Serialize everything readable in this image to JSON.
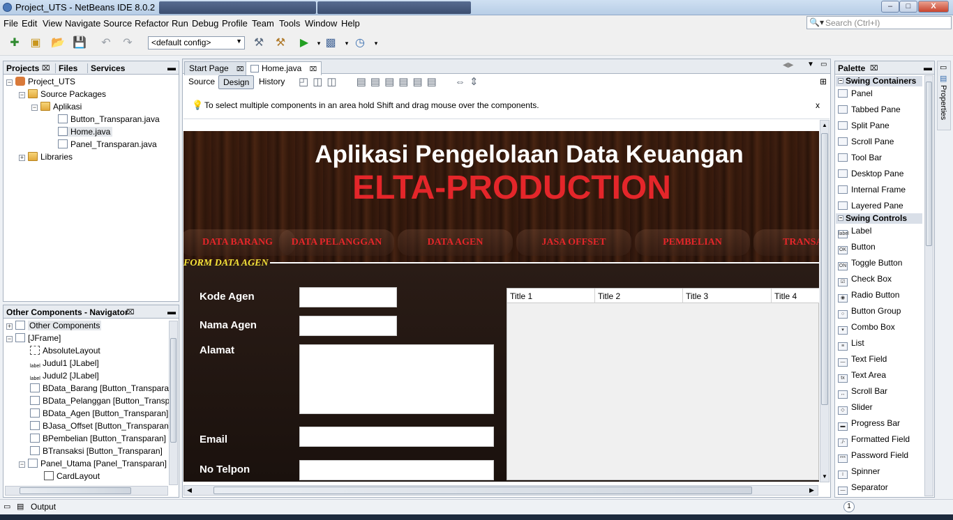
{
  "window": {
    "title": "Project_UTS - NetBeans IDE 8.0.2"
  },
  "menu": [
    "File",
    "Edit",
    "View",
    "Navigate",
    "Source",
    "Refactor",
    "Run",
    "Debug",
    "Profile",
    "Team",
    "Tools",
    "Window",
    "Help"
  ],
  "search": {
    "placeholder": "Search (Ctrl+I)"
  },
  "toolbar": {
    "config_value": "<default config>"
  },
  "projects_panel": {
    "tabs": [
      "Projects",
      "Files",
      "Services"
    ],
    "tree": [
      {
        "label": "Project_UTS"
      },
      {
        "label": "Source Packages"
      },
      {
        "label": "Aplikasi"
      },
      {
        "label": "Button_Transparan.java"
      },
      {
        "label": "Home.java"
      },
      {
        "label": "Panel_Transparan.java"
      },
      {
        "label": "Libraries"
      }
    ]
  },
  "navigator": {
    "title": "Other Components - Navigator",
    "items": [
      "Other Components",
      "[JFrame]",
      "AbsoluteLayout",
      "Judul1 [JLabel]",
      "Judul2 [JLabel]",
      "BData_Barang [Button_Transparan]",
      "BData_Pelanggan [Button_Transpar",
      "BData_Agen [Button_Transparan]",
      "BJasa_Offset [Button_Transparan]",
      "BPembelian [Button_Transparan]",
      "BTransaksi [Button_Transparan]",
      "Panel_Utama [Panel_Transparan]",
      "CardLayout"
    ],
    "label_icon": "label"
  },
  "editor": {
    "tabs": [
      "Start Page",
      "Home.java"
    ],
    "views": [
      "Source",
      "Design",
      "History"
    ],
    "hint": "To select multiple components in an area hold Shift and drag mouse over the components.",
    "hint_close": "x"
  },
  "design": {
    "title": "Aplikasi Pengelolaan Data Keuangan",
    "subtitle": "ELTA-PRODUCTION",
    "nav": [
      "DATA BARANG",
      "DATA PELANGGAN",
      "DATA AGEN",
      "JASA OFFSET",
      "PEMBELIAN",
      "TRANSA"
    ],
    "form_title": "FORM DATA AGEN",
    "fields": [
      "Kode Agen",
      "Nama Agen",
      "Alamat",
      "Email",
      "No Telpon"
    ],
    "table_headers": [
      "Title 1",
      "Title 2",
      "Title 3",
      "Title 4"
    ]
  },
  "palette": {
    "title": "Palette",
    "side_tab": "Properties",
    "groups": [
      {
        "name": "Swing Containers",
        "items": [
          "Panel",
          "Tabbed Pane",
          "Split Pane",
          "Scroll Pane",
          "Tool Bar",
          "Desktop Pane",
          "Internal Frame",
          "Layered Pane"
        ]
      },
      {
        "name": "Swing Controls",
        "items": [
          "Label",
          "Button",
          "Toggle Button",
          "Check Box",
          "Radio Button",
          "Button Group",
          "Combo Box",
          "List",
          "Text Field",
          "Text Area",
          "Scroll Bar",
          "Slider",
          "Progress Bar",
          "Formatted Field",
          "Password Field",
          "Spinner",
          "Separator"
        ]
      }
    ],
    "item_icons": [
      "label",
      "OK",
      "ON",
      "☑",
      "◉",
      "○",
      "▾",
      "≡",
      "—",
      "tx",
      "↔",
      "◇",
      "▬",
      "./-",
      "***",
      "↕",
      "—"
    ]
  },
  "status": {
    "output_label": "Output",
    "notification_count": "1"
  },
  "colors": {
    "accent_red": "#e4262a",
    "title_white": "#ffffff",
    "form_title": "#f2e23a"
  }
}
